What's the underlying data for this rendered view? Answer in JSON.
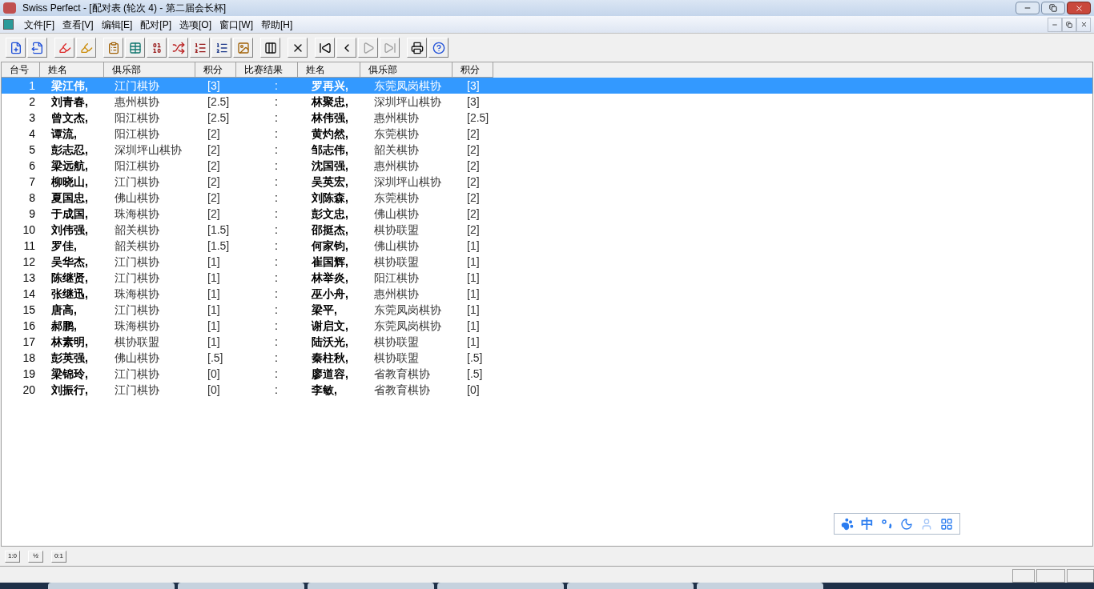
{
  "window": {
    "title": "Swiss Perfect - [配对表  (轮次 4) - 第二届会长杯]"
  },
  "menu": [
    "文件[F]",
    "查看[V]",
    "编辑[E]",
    "配对[P]",
    "选项[O]",
    "窗口[W]",
    "帮助[H]"
  ],
  "toolbar": [
    [
      {
        "kind": "new",
        "disabled": false
      },
      {
        "kind": "export",
        "disabled": false
      }
    ],
    [
      {
        "kind": "marker",
        "disabled": false
      },
      {
        "kind": "marker-dots",
        "disabled": false
      }
    ],
    [
      {
        "kind": "table-yellow",
        "disabled": false
      },
      {
        "kind": "table-teal",
        "disabled": false
      },
      {
        "kind": "binary",
        "disabled": false
      },
      {
        "kind": "shuffle",
        "disabled": false
      },
      {
        "kind": "rank-red",
        "disabled": false
      },
      {
        "kind": "rank-blue",
        "disabled": false
      },
      {
        "kind": "picture",
        "disabled": false
      }
    ],
    [
      {
        "kind": "columns",
        "disabled": false
      }
    ],
    [
      {
        "kind": "cross",
        "disabled": false
      }
    ],
    [
      {
        "kind": "first",
        "disabled": false
      },
      {
        "kind": "prev",
        "disabled": false
      },
      {
        "kind": "next",
        "disabled": true
      },
      {
        "kind": "last",
        "disabled": true
      }
    ],
    [
      {
        "kind": "print",
        "disabled": false
      },
      {
        "kind": "help",
        "disabled": false
      }
    ]
  ],
  "table": {
    "columns": [
      "台号",
      "姓名",
      "俱乐部",
      "积分",
      "比赛结果",
      "姓名",
      "俱乐部",
      "积分"
    ],
    "rows": [
      {
        "board": "1",
        "white": "梁江伟,",
        "white_club": "江门棋协",
        "white_score": "[3]",
        "result": ":",
        "black": "罗再兴,",
        "black_club": "东莞凤岗棋协",
        "black_score": "[3]",
        "selected": true
      },
      {
        "board": "2",
        "white": "刘青春,",
        "white_club": "惠州棋协",
        "white_score": "[2.5]",
        "result": ":",
        "black": "林聚忠,",
        "black_club": "深圳坪山棋协",
        "black_score": "[3]",
        "selected": false
      },
      {
        "board": "3",
        "white": "曾文杰,",
        "white_club": "阳江棋协",
        "white_score": "[2.5]",
        "result": ":",
        "black": "林伟强,",
        "black_club": "惠州棋协",
        "black_score": "[2.5]",
        "selected": false
      },
      {
        "board": "4",
        "white": "谭流,",
        "white_club": "阳江棋协",
        "white_score": "[2]",
        "result": ":",
        "black": "黄灼然,",
        "black_club": "东莞棋协",
        "black_score": "[2]",
        "selected": false
      },
      {
        "board": "5",
        "white": "彭志忍,",
        "white_club": "深圳坪山棋协",
        "white_score": "[2]",
        "result": ":",
        "black": "邹志伟,",
        "black_club": "韶关棋协",
        "black_score": "[2]",
        "selected": false
      },
      {
        "board": "6",
        "white": "梁远航,",
        "white_club": "阳江棋协",
        "white_score": "[2]",
        "result": ":",
        "black": "沈国强,",
        "black_club": "惠州棋协",
        "black_score": "[2]",
        "selected": false
      },
      {
        "board": "7",
        "white": "柳晓山,",
        "white_club": "江门棋协",
        "white_score": "[2]",
        "result": ":",
        "black": "吴英宏,",
        "black_club": "深圳坪山棋协",
        "black_score": "[2]",
        "selected": false
      },
      {
        "board": "8",
        "white": "夏国忠,",
        "white_club": "佛山棋协",
        "white_score": "[2]",
        "result": ":",
        "black": "刘陈森,",
        "black_club": "东莞棋协",
        "black_score": "[2]",
        "selected": false
      },
      {
        "board": "9",
        "white": "于成国,",
        "white_club": "珠海棋协",
        "white_score": "[2]",
        "result": ":",
        "black": "彭文忠,",
        "black_club": "佛山棋协",
        "black_score": "[2]",
        "selected": false
      },
      {
        "board": "10",
        "white": "刘伟强,",
        "white_club": "韶关棋协",
        "white_score": "[1.5]",
        "result": ":",
        "black": "邵挺杰,",
        "black_club": "棋协联盟",
        "black_score": "[2]",
        "selected": false
      },
      {
        "board": "11",
        "white": "罗佳,",
        "white_club": "韶关棋协",
        "white_score": "[1.5]",
        "result": ":",
        "black": "何家钧,",
        "black_club": "佛山棋协",
        "black_score": "[1]",
        "selected": false
      },
      {
        "board": "12",
        "white": "吴华杰,",
        "white_club": "江门棋协",
        "white_score": "[1]",
        "result": ":",
        "black": "崔国辉,",
        "black_club": "棋协联盟",
        "black_score": "[1]",
        "selected": false
      },
      {
        "board": "13",
        "white": "陈继贤,",
        "white_club": "江门棋协",
        "white_score": "[1]",
        "result": ":",
        "black": "林举炎,",
        "black_club": "阳江棋协",
        "black_score": "[1]",
        "selected": false
      },
      {
        "board": "14",
        "white": "张继迅,",
        "white_club": "珠海棋协",
        "white_score": "[1]",
        "result": ":",
        "black": "巫小舟,",
        "black_club": "惠州棋协",
        "black_score": "[1]",
        "selected": false
      },
      {
        "board": "15",
        "white": "唐高,",
        "white_club": "江门棋协",
        "white_score": "[1]",
        "result": ":",
        "black": "梁平,",
        "black_club": "东莞凤岗棋协",
        "black_score": "[1]",
        "selected": false
      },
      {
        "board": "16",
        "white": "郝鹏,",
        "white_club": "珠海棋协",
        "white_score": "[1]",
        "result": ":",
        "black": "谢启文,",
        "black_club": "东莞凤岗棋协",
        "black_score": "[1]",
        "selected": false
      },
      {
        "board": "17",
        "white": "林素明,",
        "white_club": "棋协联盟",
        "white_score": "[1]",
        "result": ":",
        "black": "陆沃光,",
        "black_club": "棋协联盟",
        "black_score": "[1]",
        "selected": false
      },
      {
        "board": "18",
        "white": "彭英强,",
        "white_club": "佛山棋协",
        "white_score": "[.5]",
        "result": ":",
        "black": "秦柱秋,",
        "black_club": "棋协联盟",
        "black_score": "[.5]",
        "selected": false
      },
      {
        "board": "19",
        "white": "梁锦玲,",
        "white_club": "江门棋协",
        "white_score": "[0]",
        "result": ":",
        "black": "廖道容,",
        "black_club": "省教育棋协",
        "black_score": "[.5]",
        "selected": false
      },
      {
        "board": "20",
        "white": "刘振行,",
        "white_club": "江门棋协",
        "white_score": "[0]",
        "result": ":",
        "black": "李敏,",
        "black_club": "省教育棋协",
        "black_score": "[0]",
        "selected": false
      }
    ]
  },
  "ime_bar": {
    "mode": "中"
  },
  "result_buttons": [
    "1:0",
    "½",
    "0:1"
  ]
}
